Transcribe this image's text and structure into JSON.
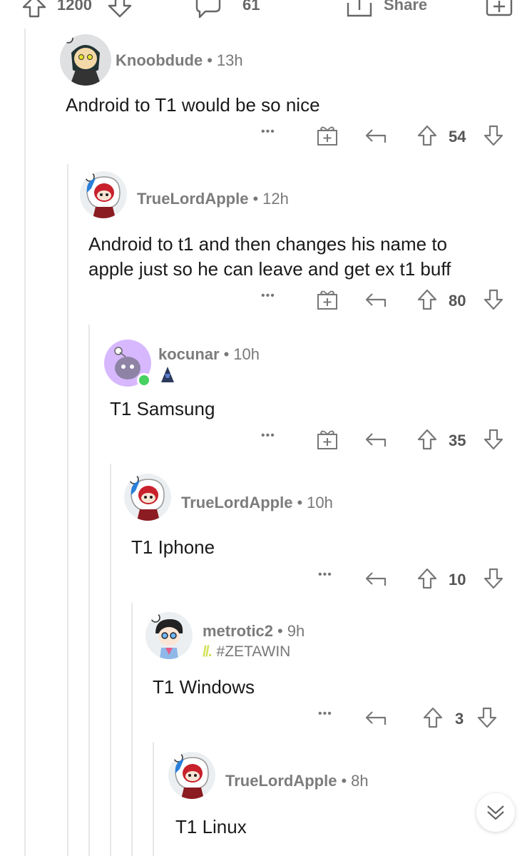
{
  "post_bar": {
    "upvotes": "1200",
    "comments": "61",
    "share_label": "Share"
  },
  "comments": [
    {
      "user": "Knoobdude",
      "time": "13h",
      "text": [
        "Android to T1 would be so nice"
      ],
      "votes": "54",
      "has_award": true
    },
    {
      "user": "TrueLordApple",
      "time": "12h",
      "text": [
        "Android to t1 and then changes his name to",
        "apple just so he can leave and get ex t1 buff"
      ],
      "votes": "80",
      "has_award": true
    },
    {
      "user": "kocunar",
      "time": "10h",
      "text": [
        "T1 Samsung"
      ],
      "votes": "35",
      "has_award": true
    },
    {
      "user": "TrueLordApple",
      "time": "10h",
      "text": [
        "T1 Iphone"
      ],
      "votes": "10",
      "has_award": false
    },
    {
      "user": "metrotic2",
      "time": "9h",
      "flair": "#ZETAWIN",
      "text": [
        "T1 Windows"
      ],
      "votes": "3",
      "has_award": false
    },
    {
      "user": "TrueLordApple",
      "time": "8h",
      "text": [
        "T1 Linux"
      ]
    }
  ],
  "separator": "•",
  "more_label": "•••",
  "colors": {
    "online": "#46d160",
    "flair": "#d4e157",
    "kocunar_bg": "#d7b8ff"
  },
  "icons": [
    "upvote-icon",
    "downvote-icon",
    "comment-icon",
    "share-icon",
    "award-icon",
    "reply-icon",
    "more-icon",
    "chevron-down-icon"
  ]
}
